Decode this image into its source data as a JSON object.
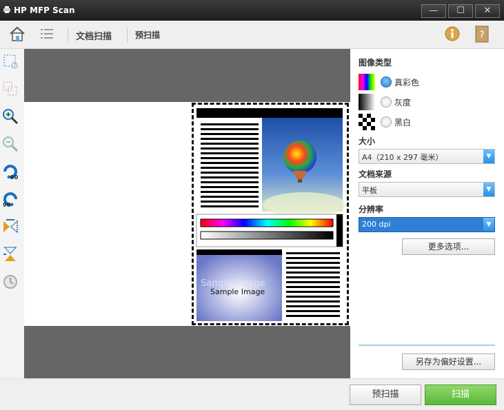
{
  "window": {
    "title": "HP MFP Scan",
    "minimize": "—",
    "maximize": "☐",
    "close": "✕"
  },
  "toolbar": {
    "tab_document_scan": "文档扫描",
    "tab_prescan": "预扫描"
  },
  "preview": {
    "sample_label": "Sample Image"
  },
  "image_type": {
    "label": "图像类型",
    "options": [
      {
        "label": "真彩色",
        "selected": true
      },
      {
        "label": "灰度",
        "selected": false
      },
      {
        "label": "黑白",
        "selected": false
      }
    ]
  },
  "size": {
    "label": "大小",
    "value": "A4（210 x 297 毫米）"
  },
  "source": {
    "label": "文档来源",
    "value": "平板"
  },
  "resolution": {
    "label": "分辨率",
    "value": "200 dpi"
  },
  "buttons": {
    "more_options": "更多选项...",
    "save_preferences": "另存为偏好设置...",
    "prescan": "预扫描",
    "scan": "扫描"
  },
  "colors": {
    "accent": "#2f7fd6",
    "scan_button": "#6cc24a",
    "preview_bg": "#666666"
  }
}
